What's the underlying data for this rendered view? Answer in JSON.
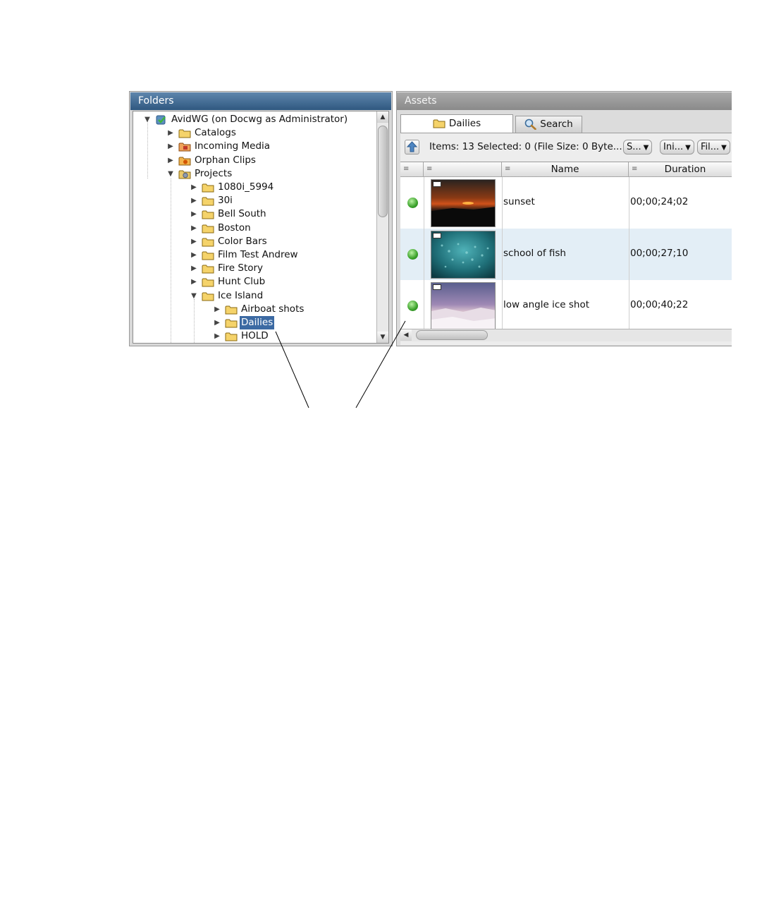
{
  "folders": {
    "title": "Folders",
    "tree": [
      {
        "label": "AvidWG (on Docwg as Administrator)",
        "depth": 0,
        "expanded": true,
        "icon": "server-check-icon"
      },
      {
        "label": "Catalogs",
        "depth": 1,
        "expanded": false,
        "icon": "folder-icon"
      },
      {
        "label": "Incoming Media",
        "depth": 1,
        "expanded": false,
        "icon": "incoming-media-folder-icon"
      },
      {
        "label": "Orphan Clips",
        "depth": 1,
        "expanded": false,
        "icon": "orphan-clips-folder-icon"
      },
      {
        "label": "Projects",
        "depth": 1,
        "expanded": true,
        "icon": "projects-folder-icon"
      },
      {
        "label": "1080i_5994",
        "depth": 2,
        "expanded": false,
        "icon": "folder-icon"
      },
      {
        "label": "30i",
        "depth": 2,
        "expanded": false,
        "icon": "folder-icon"
      },
      {
        "label": "Bell South",
        "depth": 2,
        "expanded": false,
        "icon": "folder-icon"
      },
      {
        "label": "Boston",
        "depth": 2,
        "expanded": false,
        "icon": "folder-icon"
      },
      {
        "label": "Color Bars",
        "depth": 2,
        "expanded": false,
        "icon": "folder-icon"
      },
      {
        "label": "Film Test Andrew",
        "depth": 2,
        "expanded": false,
        "icon": "folder-icon"
      },
      {
        "label": "Fire Story",
        "depth": 2,
        "expanded": false,
        "icon": "folder-icon"
      },
      {
        "label": "Hunt Club",
        "depth": 2,
        "expanded": false,
        "icon": "folder-icon"
      },
      {
        "label": "Ice Island",
        "depth": 2,
        "expanded": true,
        "icon": "folder-icon"
      },
      {
        "label": "Airboat shots",
        "depth": 3,
        "expanded": false,
        "icon": "folder-icon"
      },
      {
        "label": "Dailies",
        "depth": 3,
        "expanded": false,
        "icon": "folder-icon",
        "selected": true
      },
      {
        "label": "HOLD",
        "depth": 3,
        "expanded": false,
        "icon": "folder-icon"
      }
    ]
  },
  "assets": {
    "title": "Assets",
    "tabs": [
      {
        "label": "Dailies",
        "icon": "folder-icon",
        "active": true
      },
      {
        "label": "Search",
        "icon": "magnifier-icon",
        "active": false
      }
    ],
    "status": "Items: 13 Selected: 0 (File Size: 0 Byte...",
    "dropdowns": [
      {
        "label": "S..."
      },
      {
        "label": "Ini..."
      },
      {
        "label": "Fil..."
      }
    ],
    "columns": [
      {
        "label": ""
      },
      {
        "label": ""
      },
      {
        "label": "Name"
      },
      {
        "label": "Duration"
      }
    ],
    "rows": [
      {
        "name": "sunset",
        "duration": "00;00;24;02",
        "status_color": "#3aa12a",
        "thumb": "sunset"
      },
      {
        "name": "school of fish",
        "duration": "00;00;27;10",
        "status_color": "#3aa12a",
        "thumb": "fish"
      },
      {
        "name": "low angle ice shot",
        "duration": "00;00;40;22",
        "status_color": "#3aa12a",
        "thumb": "ice"
      }
    ]
  },
  "colors": {
    "folders_header": "#2f5880",
    "selection": "#3c6aa3",
    "alt_row": "#e3eef6"
  }
}
